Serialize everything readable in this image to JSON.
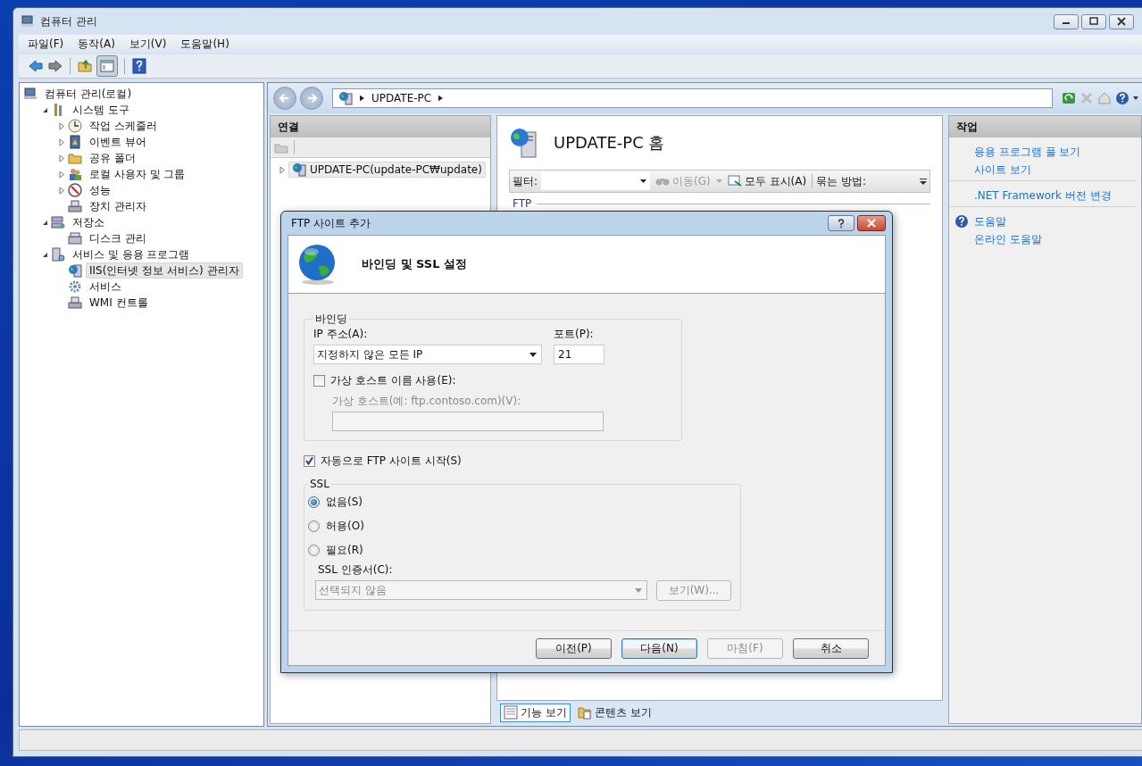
{
  "window": {
    "title": "컴퓨터 관리"
  },
  "menu": [
    {
      "label": "파일(F)"
    },
    {
      "label": "동작(A)"
    },
    {
      "label": "보기(V)"
    },
    {
      "label": "도움말(H)"
    }
  ],
  "tree": [
    {
      "label": "컴퓨터 관리(로컬)",
      "selected": false,
      "children": [
        {
          "label": "시스템 도구",
          "expanded": true,
          "selected": false,
          "children": [
            {
              "label": "작업 스케줄러",
              "expanded": false,
              "selected": false
            },
            {
              "label": "이벤트 뷰어",
              "expanded": false,
              "selected": false
            },
            {
              "label": "공유 폴더",
              "expanded": false,
              "selected": false
            },
            {
              "label": "로컬 사용자 및 그룹",
              "expanded": false,
              "selected": false
            },
            {
              "label": "성능",
              "expanded": false,
              "selected": false
            },
            {
              "label": "장치 관리자",
              "selected": false
            }
          ]
        },
        {
          "label": "저장소",
          "expanded": true,
          "selected": false,
          "children": [
            {
              "label": "디스크 관리",
              "selected": false
            }
          ]
        },
        {
          "label": "서비스 및 응용 프로그램",
          "expanded": true,
          "selected": false,
          "children": [
            {
              "label": "IIS(인터넷 정보 서비스) 관리자",
              "selected": true
            },
            {
              "label": "서비스",
              "selected": false
            },
            {
              "label": "WMI 컨트롤",
              "selected": false
            }
          ]
        }
      ]
    }
  ],
  "iis": {
    "address": [
      "UPDATE-PC"
    ],
    "connections": {
      "title": "연결",
      "items": [
        {
          "label": "UPDATE-PC(update-PC₩update)",
          "expanded": false,
          "selected": true
        }
      ]
    },
    "home": {
      "title": "UPDATE-PC 홈",
      "filter_label": "필터:",
      "go": "이동(G)",
      "show_all": "모두 표시(A)",
      "group_by": "묶는 방법:",
      "group": "FTP"
    },
    "views": [
      {
        "label": "기능 보기",
        "selected": true
      },
      {
        "label": "콘텐츠 보기",
        "selected": false
      }
    ],
    "actions": {
      "title": "작업",
      "groups": [
        [
          {
            "label": "응용 프로그램 풀 보기",
            "kind": "link"
          },
          {
            "label": "사이트 보기",
            "kind": "link"
          }
        ],
        [
          {
            "label": ".NET Framework 버전 변경",
            "kind": "link"
          }
        ],
        [
          {
            "label": "도움말",
            "kind": "help"
          },
          {
            "label": "온라인 도움말",
            "kind": "link"
          }
        ]
      ]
    }
  },
  "dialog": {
    "title": "FTP 사이트 추가",
    "heading": "바인딩 및 SSL 설정",
    "binding": {
      "legend": "바인딩",
      "ip_label": "IP 주소(A):",
      "ip_value": "지정하지 않은 모든 IP",
      "port_label": "포트(P):",
      "port_value": "21",
      "virtual_host": {
        "label": "가상 호스트 이름 사용(E):",
        "checked": false
      },
      "host_label": "가상 호스트(예: ftp.contoso.com)(V):",
      "host_disabled": true
    },
    "auto_start": {
      "label": "자동으로 FTP 사이트 시작(S)",
      "checked": true
    },
    "ssl": {
      "legend": "SSL",
      "options": [
        {
          "label": "없음(S)",
          "selected": true
        },
        {
          "label": "허용(O)",
          "selected": false
        },
        {
          "label": "필요(R)",
          "selected": false
        }
      ],
      "cert_label": "SSL 인증서(C):",
      "cert_value": "선택되지 않음",
      "cert_disabled": true,
      "view_button": {
        "label": "보기(W)...",
        "disabled": true
      }
    },
    "buttons": [
      {
        "label": "이전(P)",
        "disabled": false,
        "default": false
      },
      {
        "label": "다음(N)",
        "disabled": false,
        "default": true
      },
      {
        "label": "마침(F)",
        "disabled": true,
        "default": false
      },
      {
        "label": "취소",
        "disabled": false,
        "default": false
      }
    ]
  }
}
